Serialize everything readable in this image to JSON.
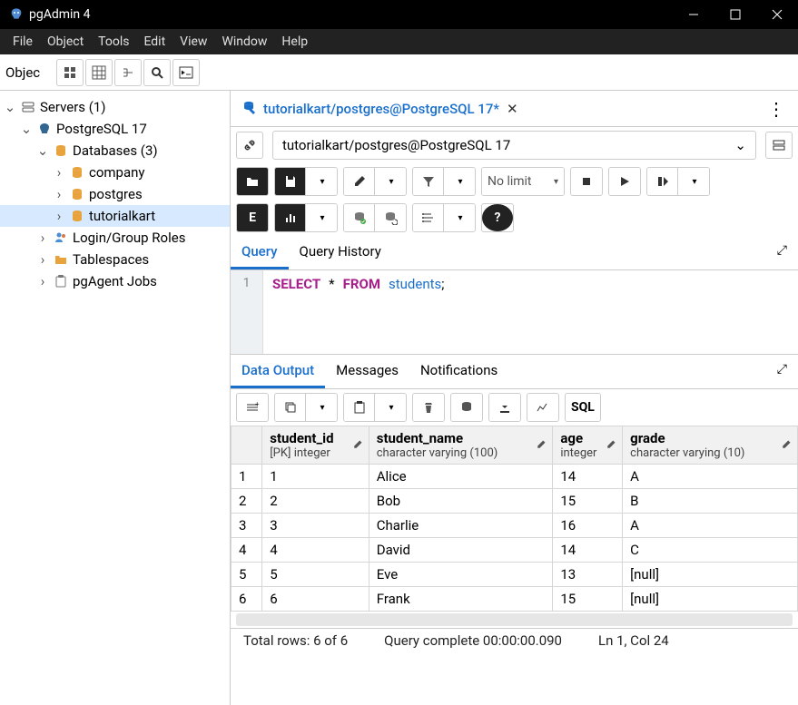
{
  "title": "pgAdmin 4",
  "menu": [
    "File",
    "Object",
    "Tools",
    "Edit",
    "View",
    "Window",
    "Help"
  ],
  "object_label": "Objec",
  "tree": {
    "servers": "Servers (1)",
    "pg17": "PostgreSQL 17",
    "databases": "Databases (3)",
    "db_company": "company",
    "db_postgres": "postgres",
    "db_tutorial": "tutorialkart",
    "login_roles": "Login/Group Roles",
    "tablespaces": "Tablespaces",
    "pgagent": "pgAgent Jobs"
  },
  "tab_label": "tutorialkart/postgres@PostgreSQL 17*",
  "conn_label": "tutorialkart/postgres@PostgreSQL 17",
  "nolimit": "No limit",
  "qtabs": {
    "query": "Query",
    "history": "Query History"
  },
  "gutter_line": "1",
  "sql": {
    "select": "SELECT",
    "star": "*",
    "from": "FROM",
    "tbl": "students",
    "semi": ";"
  },
  "otabs": {
    "data": "Data Output",
    "msg": "Messages",
    "notif": "Notifications"
  },
  "sql_btn": "SQL",
  "columns": [
    {
      "name": "student_id",
      "type": "[PK] integer"
    },
    {
      "name": "student_name",
      "type": "character varying (100)"
    },
    {
      "name": "age",
      "type": "integer"
    },
    {
      "name": "grade",
      "type": "character varying (10)"
    }
  ],
  "rows": [
    {
      "n": "1",
      "id": "1",
      "name": "Alice",
      "age": "14",
      "grade": "A"
    },
    {
      "n": "2",
      "id": "2",
      "name": "Bob",
      "age": "15",
      "grade": "B"
    },
    {
      "n": "3",
      "id": "3",
      "name": "Charlie",
      "age": "16",
      "grade": "A"
    },
    {
      "n": "4",
      "id": "4",
      "name": "David",
      "age": "14",
      "grade": "C"
    },
    {
      "n": "5",
      "id": "5",
      "name": "Eve",
      "age": "13",
      "grade": "[null]"
    },
    {
      "n": "6",
      "id": "6",
      "name": "Frank",
      "age": "15",
      "grade": "[null]"
    }
  ],
  "status": {
    "rows": "Total rows: 6 of 6",
    "qc": "Query complete 00:00:00.090",
    "pos": "Ln 1, Col 24"
  }
}
